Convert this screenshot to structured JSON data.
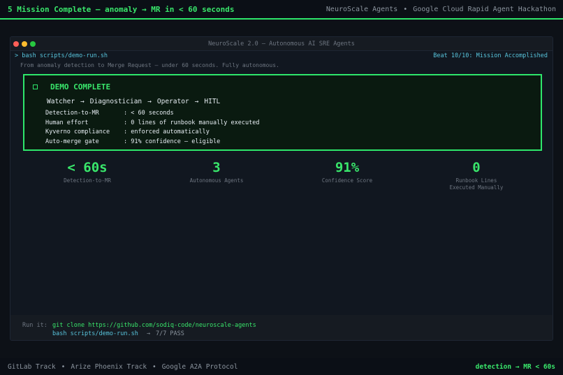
{
  "header": {
    "title": "5  Mission Complete — anomaly → MR in < 60 seconds",
    "right": [
      "NeuroScale Agents",
      "Google Cloud Rapid Agent Hackathon"
    ],
    "separator": "•"
  },
  "window": {
    "title": "NeuroScale 2.0  —  Autonomous AI SRE Agents",
    "command": "> bash scripts/demo-run.sh",
    "beat": "Beat 10/10: Mission Accomplished",
    "tagline": "From anomaly detection to Merge Request — under 60 seconds. Fully autonomous."
  },
  "demo": {
    "title": "DEMO COMPLETE",
    "pipeline": [
      "Watcher",
      "Diagnostician",
      "Operator",
      "HITL"
    ],
    "arrow": "→",
    "facts": [
      {
        "key": "Detection-to-MR",
        "value": "< 60 seconds"
      },
      {
        "key": "Human effort",
        "value": "0 lines of runbook manually executed"
      },
      {
        "key": "Kyverno compliance",
        "value": "enforced automatically"
      },
      {
        "key": "Auto-merge gate",
        "value": "91% confidence — eligible"
      }
    ]
  },
  "metrics": [
    {
      "value": "< 60s",
      "label": "Detection-to-MR"
    },
    {
      "value": "3",
      "label": "Autonomous Agents"
    },
    {
      "value": "91%",
      "label": "Confidence Score"
    },
    {
      "value": "0",
      "label": "Runbook Lines Executed Manually"
    }
  ],
  "run": {
    "label": "Run it:",
    "clone": "git clone https://github.com/sodiq-code/neuroscale-agents",
    "script": "bash scripts/demo-run.sh",
    "arrow": "→",
    "result": "7/7 PASS"
  },
  "footer": {
    "tracks": [
      "GitLab Track",
      "Arize Phoenix Track",
      "Google A2A Protocol"
    ],
    "separator": "•",
    "tag": "detection → MR  <  60s"
  },
  "colors": {
    "accent": "#39e66b",
    "cyan": "#58c4dc",
    "background": "#0d1117"
  }
}
